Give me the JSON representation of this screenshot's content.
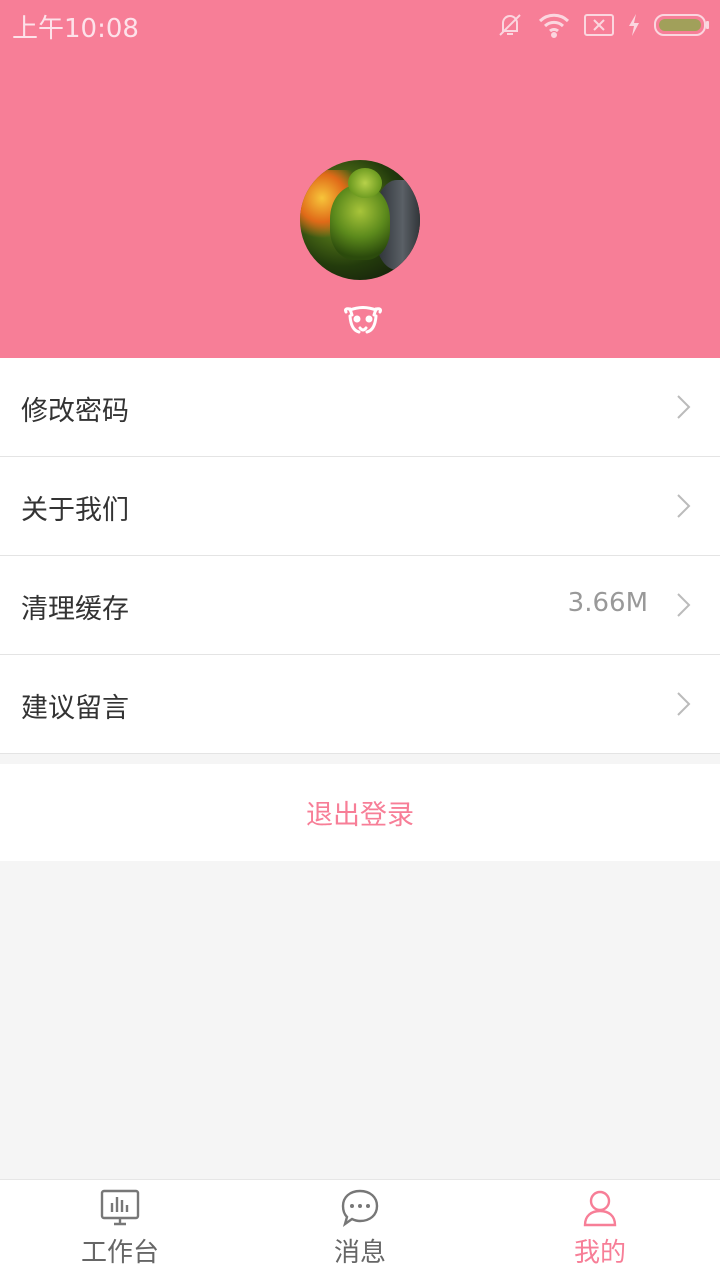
{
  "colors": {
    "accent": "#f77e97",
    "text": "#333333",
    "muted": "#999999"
  },
  "status_bar": {
    "time": "上午10:08",
    "icons": [
      "mute-icon",
      "wifi-icon",
      "no-sim-icon",
      "charging-icon",
      "battery-icon"
    ]
  },
  "profile": {
    "avatar": "avatar-image",
    "nickname_icon": "emoji-face-icon"
  },
  "menu": {
    "items": [
      {
        "label": "修改密码",
        "value": ""
      },
      {
        "label": "关于我们",
        "value": ""
      },
      {
        "label": "清理缓存",
        "value": "3.66M"
      },
      {
        "label": "建议留言",
        "value": ""
      }
    ]
  },
  "logout": {
    "label": "退出登录"
  },
  "tabbar": {
    "tabs": [
      {
        "label": "工作台",
        "icon": "dashboard-icon",
        "active": false
      },
      {
        "label": "消息",
        "icon": "chat-icon",
        "active": false
      },
      {
        "label": "我的",
        "icon": "user-icon",
        "active": true
      }
    ]
  }
}
